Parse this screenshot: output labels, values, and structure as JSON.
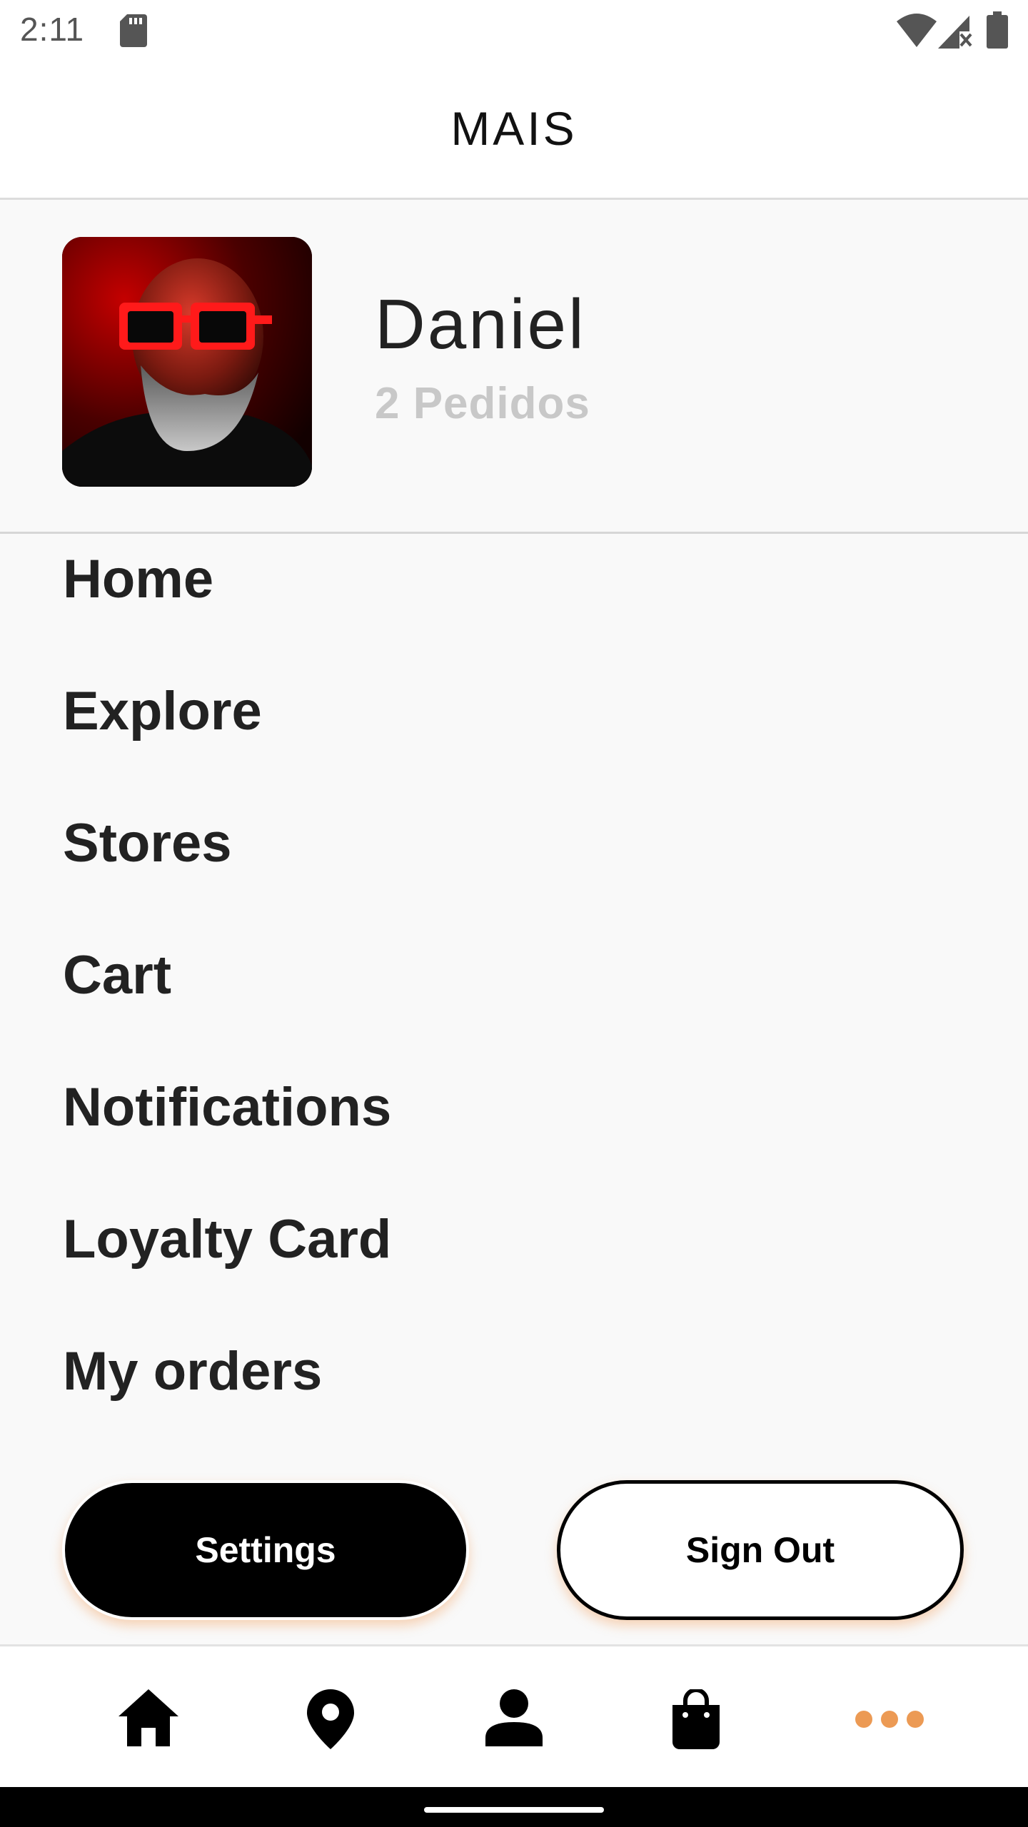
{
  "status_bar": {
    "time": "2:11",
    "icons": [
      "sd-card-icon",
      "wifi-icon",
      "signal-icon",
      "battery-icon"
    ]
  },
  "header": {
    "title": "MAIS"
  },
  "profile": {
    "name": "Daniel",
    "orders": "2 Pedidos"
  },
  "menu": {
    "items": [
      {
        "label": "Home"
      },
      {
        "label": "Explore"
      },
      {
        "label": "Stores"
      },
      {
        "label": "Cart"
      },
      {
        "label": "Notifications"
      },
      {
        "label": "Loyalty Card"
      },
      {
        "label": "My orders"
      }
    ]
  },
  "actions": {
    "settings_label": "Settings",
    "signout_label": "Sign Out"
  },
  "bottom_nav": {
    "items": [
      "home-icon",
      "location-pin-icon",
      "profile-icon",
      "shopping-bag-icon",
      "more-icon"
    ],
    "active": "more-icon"
  },
  "colors": {
    "accent": "#ec9a54",
    "text": "#222222",
    "muted": "#c8c8c8",
    "background": "#f9f9f9"
  }
}
